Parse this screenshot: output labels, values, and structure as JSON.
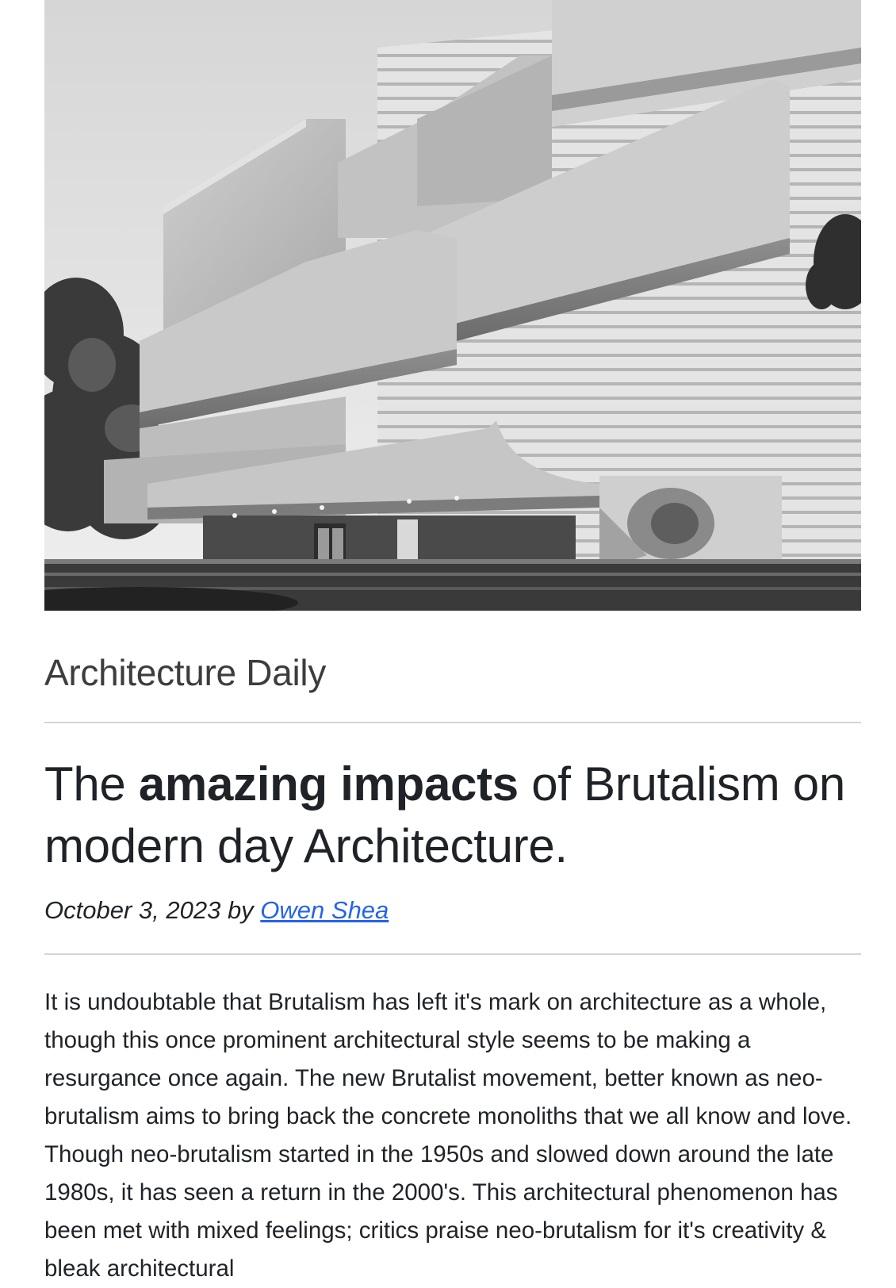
{
  "hero": {
    "alt": ""
  },
  "site": {
    "name": "Architecture Daily"
  },
  "article": {
    "title_part1": "The ",
    "title_bold": "amazing impacts",
    "title_part2": " of Brutalism on modern day Architecture.",
    "date": "October 3, 2023",
    "by": " by ",
    "author": "Owen Shea",
    "body": "It is undoubtable that Brutalism has left it's mark on architecture as a whole, though this once prominent architectural style seems to be making a resurgance once again. The new Brutalist movement, better known as neo-brutalism aims to bring back the concrete monoliths that we all know and love. Though neo-brutalism started in the 1950s and slowed down around the late 1980s, it has seen a return in the 2000's. This architectural phenomenon has been met with mixed feelings; critics praise neo-brutalism for it's creativity & bleak architectural"
  },
  "colors": {
    "link": "#2563eb",
    "text": "#1f2328",
    "site_name": "#3d3d3d",
    "rule": "#d5d5d5"
  }
}
